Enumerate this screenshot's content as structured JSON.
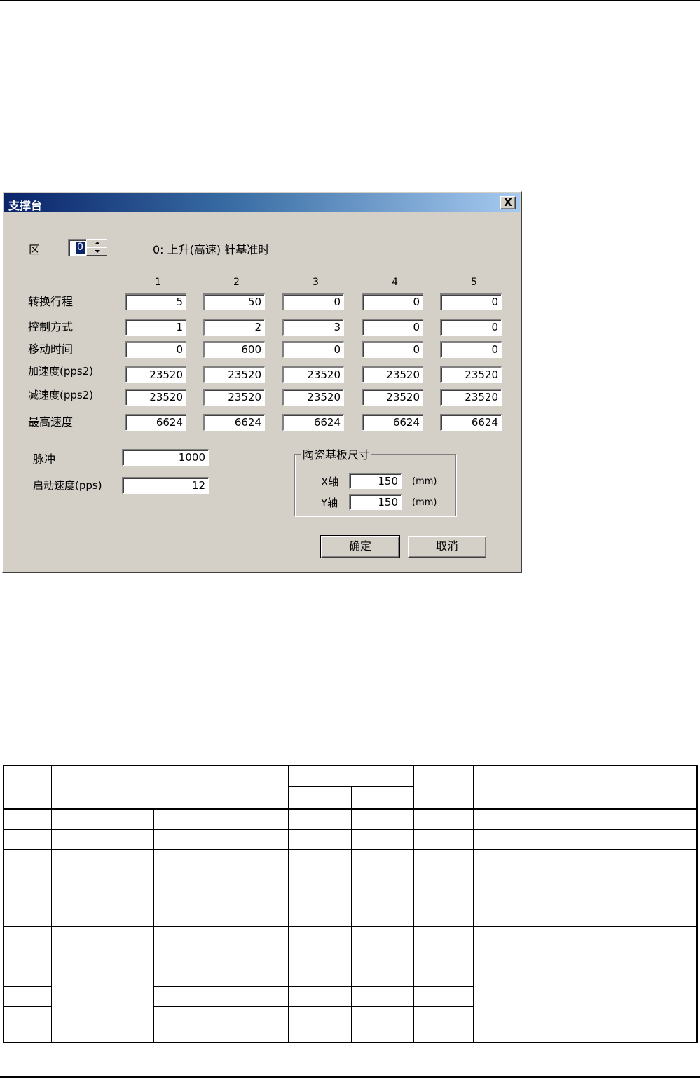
{
  "dialog": {
    "title": "支撑台",
    "close_glyph": "X",
    "zone_label": "区",
    "zone_value": "0",
    "zone_description": "0: 上升(高速) 针基准时",
    "columns": [
      "1",
      "2",
      "3",
      "4",
      "5"
    ],
    "rows": [
      {
        "label": "转换行程",
        "values": [
          "5",
          "50",
          "0",
          "0",
          "0"
        ]
      },
      {
        "label": "控制方式",
        "values": [
          "1",
          "2",
          "3",
          "0",
          "0"
        ]
      },
      {
        "label": "移动时间",
        "values": [
          "0",
          "600",
          "0",
          "0",
          "0"
        ]
      },
      {
        "label": "加速度(pps2)",
        "values": [
          "23520",
          "23520",
          "23520",
          "23520",
          "23520"
        ]
      },
      {
        "label": "减速度(pps2)",
        "values": [
          "23520",
          "23520",
          "23520",
          "23520",
          "23520"
        ]
      },
      {
        "label": "最高速度",
        "values": [
          "6624",
          "6624",
          "6624",
          "6624",
          "6624"
        ]
      }
    ],
    "pulse": {
      "label": "脉冲",
      "value": "1000"
    },
    "start_speed": {
      "label": "启动速度(pps)",
      "value": "12"
    },
    "substrate": {
      "title": "陶瓷基板尺寸",
      "x_label": "X轴",
      "x_value": "150",
      "x_unit": "(mm)",
      "y_label": "Y轴",
      "y_value": "150",
      "y_unit": "(mm)"
    },
    "ok_label": "确定",
    "cancel_label": "取消"
  }
}
